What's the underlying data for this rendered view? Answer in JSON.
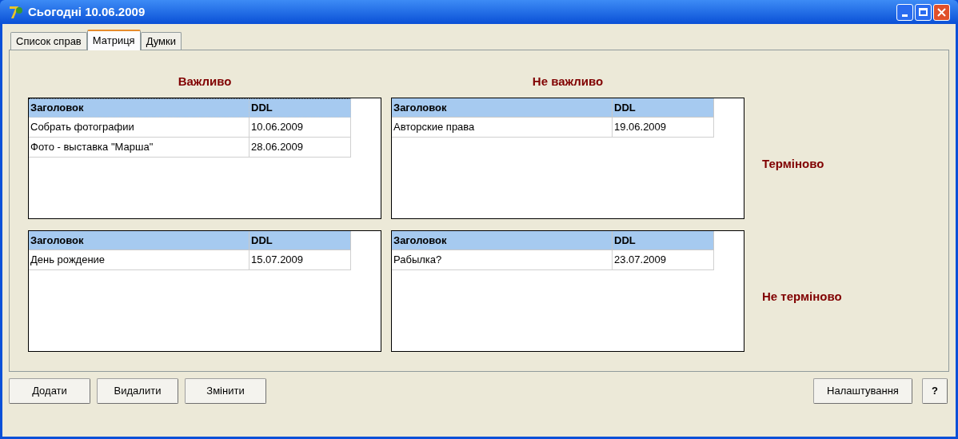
{
  "window": {
    "title": "Сьогодні 10.06.2009"
  },
  "tabs": [
    {
      "label": "Список справ",
      "selected": false
    },
    {
      "label": "Матриця",
      "selected": true
    },
    {
      "label": "Думки",
      "selected": false
    }
  ],
  "matrix": {
    "column_labels": [
      "Важливо",
      "Не важливо"
    ],
    "row_labels": [
      "Терміново",
      "Не терміново"
    ],
    "tables": [
      {
        "focused": true,
        "columns": [
          "Заголовок",
          "DDL"
        ],
        "rows": [
          [
            "Собрать фотографии",
            "10.06.2009"
          ],
          [
            "Фото - выставка \"Марша\"",
            "28.06.2009"
          ]
        ]
      },
      {
        "focused": false,
        "columns": [
          "Заголовок",
          "DDL"
        ],
        "rows": [
          [
            "Авторские права",
            "19.06.2009"
          ]
        ]
      },
      {
        "focused": false,
        "columns": [
          "Заголовок",
          "DDL"
        ],
        "rows": [
          [
            "День рождение",
            "15.07.2009"
          ]
        ]
      },
      {
        "focused": false,
        "columns": [
          "Заголовок",
          "DDL"
        ],
        "rows": [
          [
            "Рабылка?",
            "23.07.2009"
          ]
        ]
      }
    ]
  },
  "buttons_left": [
    "Додати",
    "Видалити",
    "Змінити"
  ],
  "buttons_right": [
    "Налаштування",
    "?"
  ]
}
